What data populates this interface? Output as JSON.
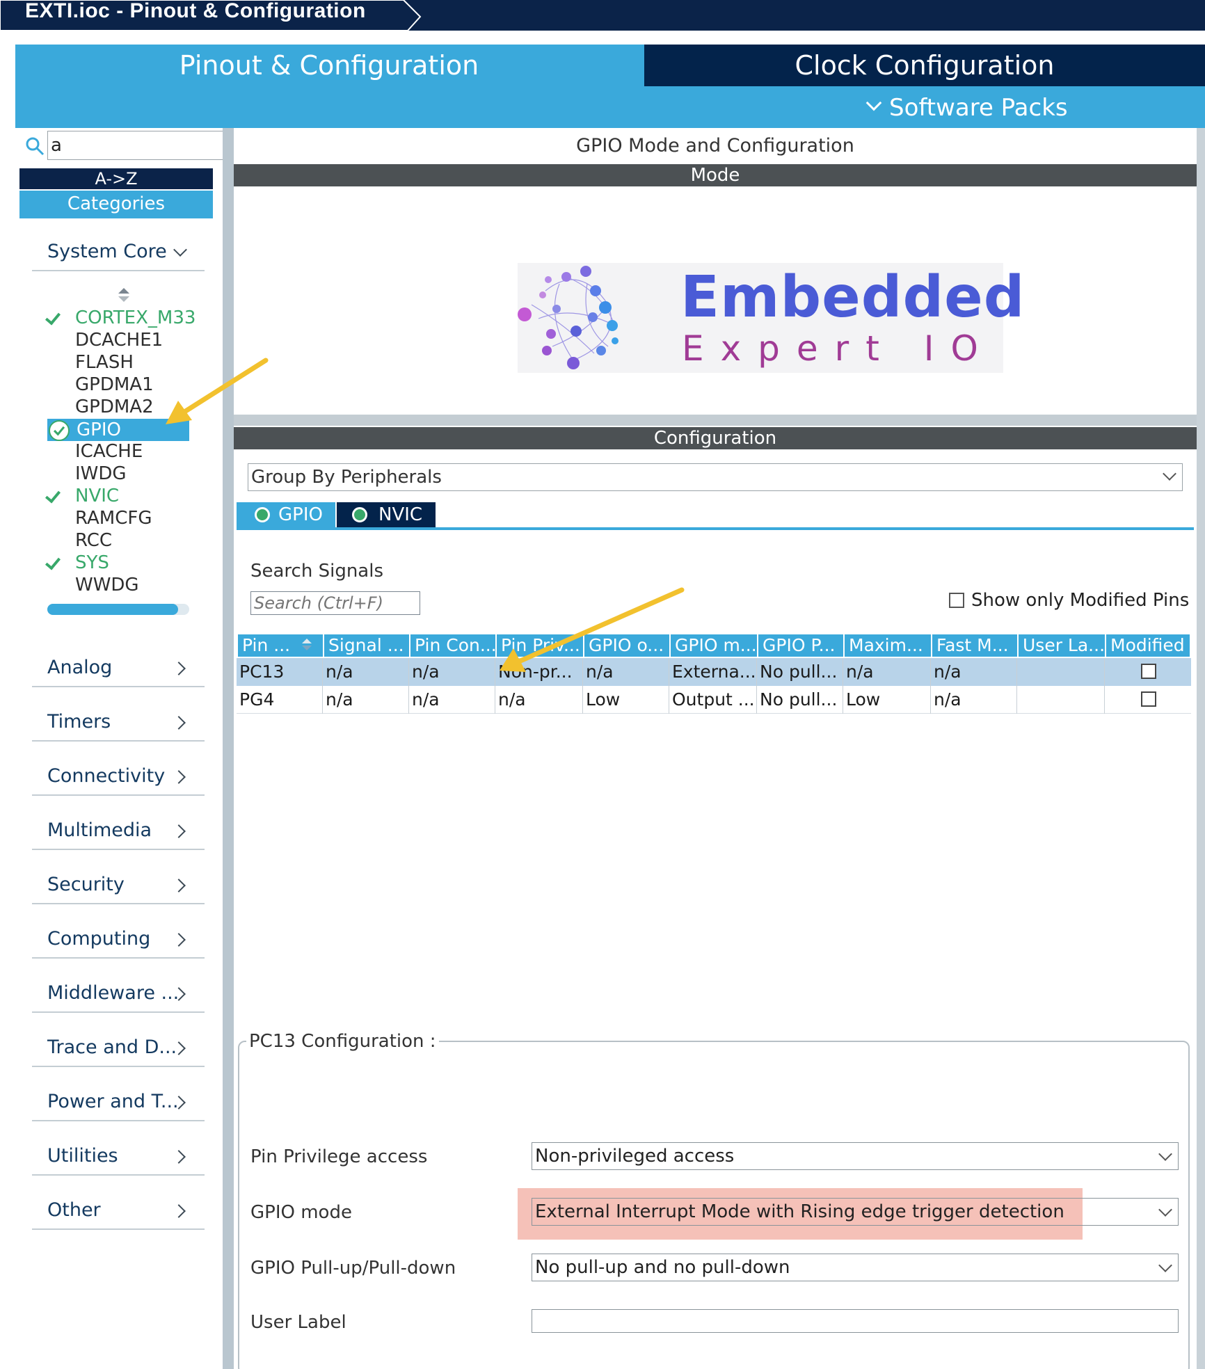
{
  "window": {
    "title": "EXTI.ioc - Pinout & Configuration"
  },
  "top_tabs": {
    "pinout": "Pinout & Configuration",
    "clock": "Clock Configuration",
    "software_packs": "Software Packs"
  },
  "sidebar": {
    "search_value": "a",
    "sort_label": "A->Z",
    "categories_label": "Categories",
    "system_core": {
      "label": "System Core",
      "items": [
        {
          "label": "CORTEX_M33",
          "configured": true
        },
        {
          "label": "DCACHE1",
          "configured": false
        },
        {
          "label": "FLASH",
          "configured": false
        },
        {
          "label": "GPDMA1",
          "configured": false
        },
        {
          "label": "GPDMA2",
          "configured": false
        },
        {
          "label": "GPIO",
          "configured": true,
          "selected": true
        },
        {
          "label": "ICACHE",
          "configured": false
        },
        {
          "label": "IWDG",
          "configured": false
        },
        {
          "label": "NVIC",
          "configured": true
        },
        {
          "label": "RAMCFG",
          "configured": false
        },
        {
          "label": "RCC",
          "configured": false
        },
        {
          "label": "SYS",
          "configured": true
        },
        {
          "label": "WWDG",
          "configured": false
        }
      ]
    },
    "categories": [
      "Analog",
      "Timers",
      "Connectivity",
      "Multimedia",
      "Security",
      "Computing",
      "Middleware ...",
      "Trace and D...",
      "Power and T...",
      "Utilities",
      "Other"
    ]
  },
  "main": {
    "panel_title": "GPIO Mode and Configuration",
    "mode_label": "Mode",
    "logo": {
      "line1": "Embedded",
      "line2": "Expert IO"
    },
    "configuration_label": "Configuration",
    "group_by": "Group By Peripherals",
    "subtabs": [
      "GPIO",
      "NVIC"
    ],
    "search_signals_label": "Search Signals",
    "search_signals_placeholder": "Search (Ctrl+F)",
    "show_modified_label": "Show only Modified Pins",
    "table": {
      "columns": [
        "Pin ...",
        "Signal ...",
        "Pin Con...",
        "Pin Priv...",
        "GPIO o...",
        "GPIO m...",
        "GPIO P...",
        "Maxim...",
        "Fast M...",
        "User La...",
        "Modified"
      ],
      "rows": [
        [
          "PC13",
          "n/a",
          "n/a",
          "Non-pr...",
          "n/a",
          "Externa...",
          "No pull...",
          "n/a",
          "n/a",
          "",
          ""
        ],
        [
          "PG4",
          "n/a",
          "n/a",
          "n/a",
          "Low",
          "Output ...",
          "No pull...",
          "Low",
          "n/a",
          "",
          ""
        ]
      ]
    },
    "pin_config": {
      "title": "PC13 Configuration :",
      "fields": [
        {
          "label": "Pin Privilege access",
          "value": "Non-privileged access"
        },
        {
          "label": "GPIO mode",
          "value": "External Interrupt Mode with Rising edge trigger detection"
        },
        {
          "label": "GPIO Pull-up/Pull-down",
          "value": "No pull-up and no pull-down"
        },
        {
          "label": "User Label",
          "value": ""
        }
      ]
    }
  },
  "colors": {
    "navy": "#03234b",
    "accent_blue": "#3aa9db",
    "ok_green": "#38a86a",
    "highlight": "#f5c1b8",
    "arrow_yellow": "#f2c12e"
  }
}
